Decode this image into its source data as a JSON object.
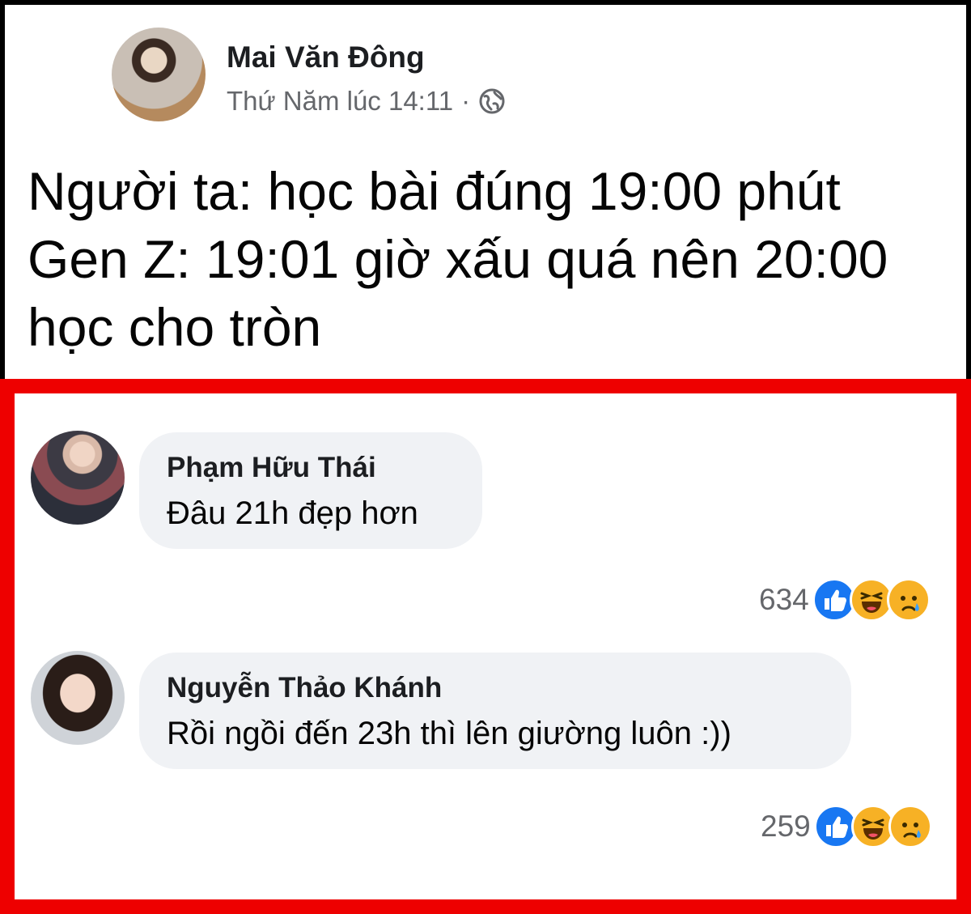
{
  "post": {
    "author": "Mai Văn Đông",
    "timestamp": "Thứ Năm lúc 14:11",
    "separator": "·",
    "privacy_icon": "globe-icon",
    "text_lines": [
      "Người ta: học bài đúng 19:00 phút",
      "Gen Z: 19:01 giờ xấu quá nên 20:00",
      "học cho tròn"
    ]
  },
  "comments": [
    {
      "author": "Phạm Hữu Thái",
      "text": "Đâu 21h đẹp hơn",
      "reaction_count": "634",
      "reaction_icons": [
        "like-icon",
        "haha-icon",
        "sad-icon"
      ]
    },
    {
      "author": "Nguyễn Thảo Khánh",
      "text": "Rồi ngồi đến 23h thì lên giường luôn :))",
      "reaction_count": "259",
      "reaction_icons": [
        "like-icon",
        "haha-icon",
        "sad-icon"
      ]
    }
  ],
  "colors": {
    "highlight_frame": "#ee0000",
    "bubble_bg": "#f0f2f5",
    "meta_text": "#65676b",
    "like_blue": "#1877f2",
    "emoji_yellow": "#f7b125"
  }
}
